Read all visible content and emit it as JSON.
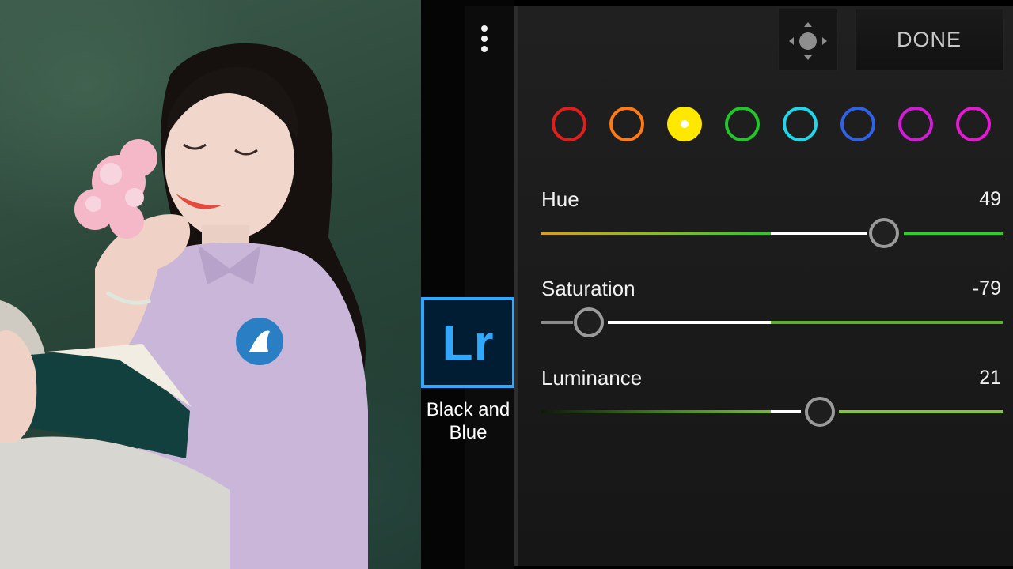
{
  "toolbar": {
    "done_label": "DONE",
    "target_icon": "target-adjust-icon",
    "menu_icon": "more-vertical-icon"
  },
  "branding": {
    "logo_text": "Lr",
    "preset_name_line1": "Black and",
    "preset_name_line2": "Blue",
    "accent": "#31a8ff"
  },
  "color_mix": {
    "selected": "yellow",
    "swatches": [
      {
        "name": "red",
        "color": "#e01e1e"
      },
      {
        "name": "orange",
        "color": "#ff7a14"
      },
      {
        "name": "yellow",
        "color": "#ffe800"
      },
      {
        "name": "green",
        "color": "#21c72a"
      },
      {
        "name": "aqua",
        "color": "#1ed7e8"
      },
      {
        "name": "blue",
        "color": "#2f62e6"
      },
      {
        "name": "purple",
        "color": "#d21bd6"
      },
      {
        "name": "magenta",
        "color": "#e31ad2"
      }
    ]
  },
  "sliders": {
    "hue": {
      "label": "Hue",
      "value": "49"
    },
    "saturation": {
      "label": "Saturation",
      "value": "-79"
    },
    "luminance": {
      "label": "Luminance",
      "value": "21"
    }
  }
}
